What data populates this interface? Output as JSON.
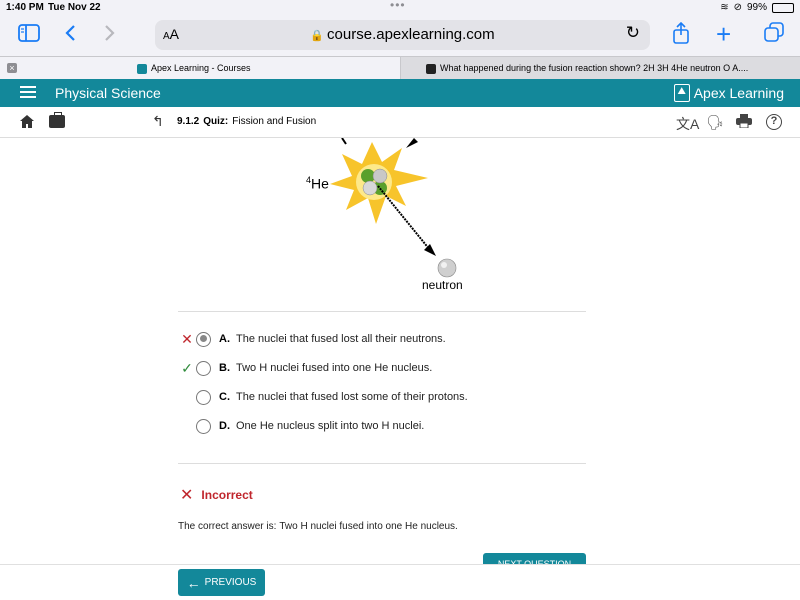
{
  "status_bar": {
    "time": "1:40 PM",
    "date": "Tue Nov 22",
    "battery_percent": "99%",
    "battery_level": 0.99
  },
  "browser": {
    "text_size_label": "AA",
    "url": "course.apexlearning.com",
    "tabs": [
      {
        "title": "Apex Learning - Courses",
        "active": true
      },
      {
        "title": "What happened during the fusion reaction shown? 2H 3H 4He neutron O A....",
        "active": false
      }
    ]
  },
  "app_header": {
    "course_title": "Physical Science",
    "logo_text": "Apex Learning"
  },
  "subheader": {
    "quiz_number": "9.1.2",
    "quiz_label": "Quiz:",
    "quiz_name": "Fission and Fusion"
  },
  "diagram": {
    "he_label_sup": "4",
    "he_label": "He",
    "neutron_label": "neutron"
  },
  "options": [
    {
      "letter": "A.",
      "text": "The nuclei that fused lost all their neutrons.",
      "selected": true,
      "mark": "wrong"
    },
    {
      "letter": "B.",
      "text": "Two H nuclei fused into one He nucleus.",
      "selected": false,
      "mark": "correct"
    },
    {
      "letter": "C.",
      "text": "The nuclei that fused lost some of their protons.",
      "selected": false,
      "mark": ""
    },
    {
      "letter": "D.",
      "text": "One He nucleus split into two H nuclei.",
      "selected": false,
      "mark": ""
    }
  ],
  "result": {
    "status": "Incorrect",
    "correct_prefix": "The correct answer is:",
    "correct_answer": "Two H nuclei fused into one He nucleus."
  },
  "buttons": {
    "next": "NEXT QUESTION",
    "previous": "PREVIOUS"
  },
  "colors": {
    "brand": "#13889a",
    "incorrect": "#c0262d",
    "correct": "#2e8b3a",
    "ios_blue": "#1a7cf5"
  }
}
